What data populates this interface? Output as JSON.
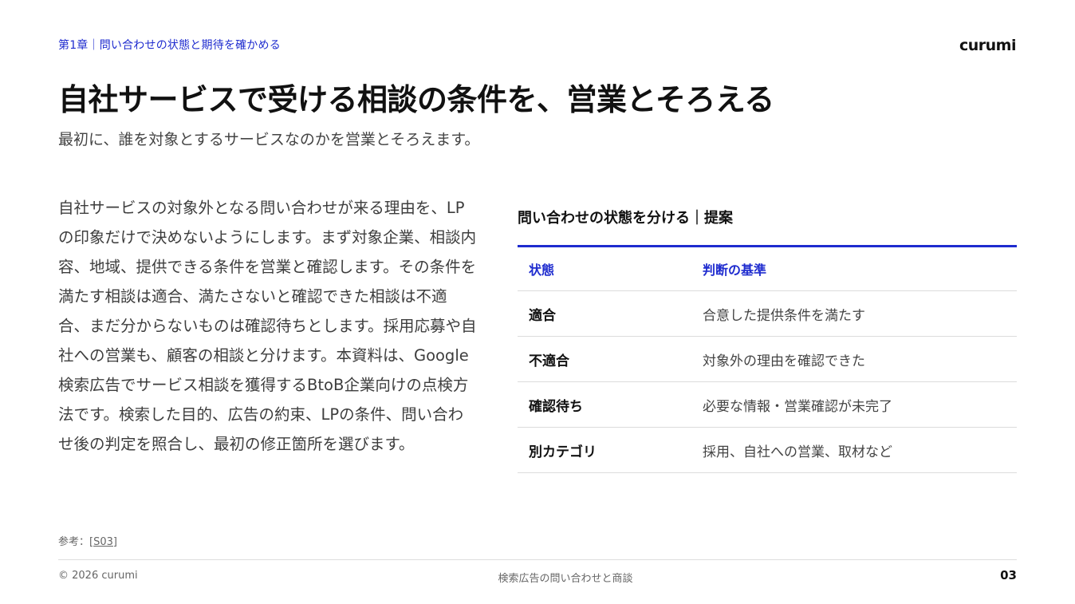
{
  "header": {
    "chapter": "第1章｜問い合わせの状態と期待を確かめる",
    "brand": "curumi"
  },
  "title": "自社サービスで受ける相談の条件を、営業とそろえる",
  "subtitle": "最初に、誰を対象とするサービスなのかを営業とそろえます。",
  "body": "自社サービスの対象外となる問い合わせが来る理由を、LPの印象だけで決めないようにします。まず対象企業、相談内容、地域、提供できる条件を営業と確認します。その条件を満たす相談は適合、満たさないと確認できた相談は不適合、まだ分からないものは確認待ちとします。採用応募や自社への営業も、顧客の相談と分けます。本資料は、Google検索広告でサービス相談を獲得するBtoB企業向けの点検方法です。検索した目的、広告の約束、LPの条件、問い合わせ後の判定を照合し、最初の修正箇所を選びます。",
  "table": {
    "title": "問い合わせの状態を分ける｜提案",
    "headers": {
      "state": "状態",
      "criteria": "判断の基準"
    },
    "rows": [
      {
        "state": "適合",
        "criteria": "合意した提供条件を満たす"
      },
      {
        "state": "不適合",
        "criteria": "対象外の理由を確認できた"
      },
      {
        "state": "確認待ち",
        "criteria": "必要な情報・営業確認が未完了"
      },
      {
        "state": "別カテゴリ",
        "criteria": "採用、自社への営業、取材など"
      }
    ]
  },
  "reference": {
    "label": "参考：",
    "link": "[S03]"
  },
  "footer": {
    "copyright": "© 2026 curumi",
    "center": "検索広告の問い合わせと商談",
    "page": "03"
  },
  "colors": {
    "accent": "#1f2ccf",
    "text": "#111111",
    "muted": "#666666",
    "rule": "#dcdcdc"
  }
}
